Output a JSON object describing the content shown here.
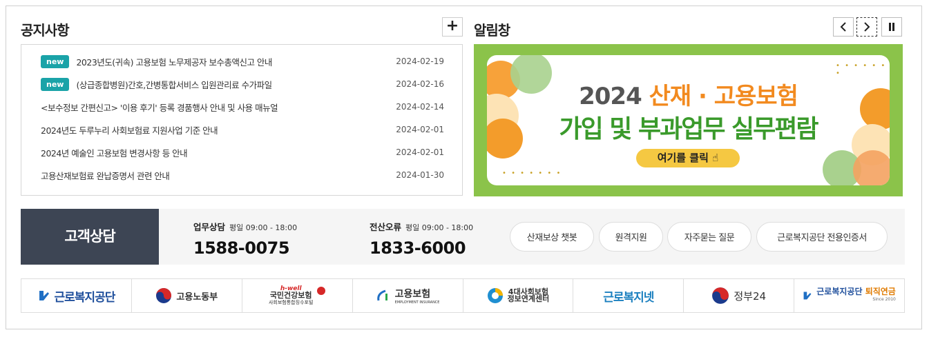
{
  "notice": {
    "title": "공지사항",
    "more_label": "+",
    "badge_label": "new",
    "items": [
      {
        "title": "2023년도(귀속) 고용보험 노무제공자 보수총액신고 안내",
        "date": "2024-02-19",
        "is_new": true
      },
      {
        "title": "(상급종합병원)간호,간병통합서비스 입원관리료 수가파일",
        "date": "2024-02-16",
        "is_new": true
      },
      {
        "title": "<보수정보 간편신고> '이용 후기' 등록 경품행사 안내 및 사용 매뉴얼",
        "date": "2024-02-14",
        "is_new": false
      },
      {
        "title": "2024년도 두루누리 사회보험료 지원사업 기준 안내",
        "date": "2024-02-01",
        "is_new": false
      },
      {
        "title": "2024년 예술인 고용보험 변경사항 등 안내",
        "date": "2024-02-01",
        "is_new": false
      },
      {
        "title": "고용산재보험료 완납증명서 관련 안내",
        "date": "2024-01-30",
        "is_new": false
      }
    ]
  },
  "alarm": {
    "title": "알림창",
    "prev_icon": "chevron-left-icon",
    "next_icon": "chevron-right-icon",
    "pause_icon": "pause-icon",
    "banner": {
      "year": "2024",
      "line1_accent": "산재 · 고용보험",
      "line2": "가입 및 부과업무 실무편람",
      "button": "여기를 클릭"
    }
  },
  "consult": {
    "label": "고객상담",
    "business": {
      "title": "업무상담",
      "hours": "평일 09:00 - 18:00",
      "phone": "1588-0075"
    },
    "it": {
      "title": "전산오류",
      "hours": "평일 09:00 - 18:00",
      "phone": "1833-6000"
    },
    "links": [
      "산재보상 챗봇",
      "원격지원",
      "자주묻는 질문",
      "근로복지공단 전용인증서"
    ]
  },
  "logos": {
    "kcomwel": "근로복지공단",
    "moel": "고용노동부",
    "nhis_top": "h-well",
    "nhis_main": "국민건강보험",
    "nhis_sub": "사회보험통합징수포털",
    "ei_main": "고용보험",
    "ei_sub": "EMPLOYMENT INSURANCE",
    "four_line1": "4대사회보험",
    "four_line2": "정보연계센터",
    "worknet": "근로복지넷",
    "gov24": "정부24",
    "pension_main": "근로복지공단",
    "pension_accent": "퇴직연금",
    "pension_since": "Since 2010"
  },
  "colors": {
    "badge": "#1aa3a8",
    "banner_bg": "#8bc34a",
    "consult_label_bg": "#3d4554",
    "accent_orange": "#f28a1f",
    "accent_green": "#3a9a2b"
  }
}
